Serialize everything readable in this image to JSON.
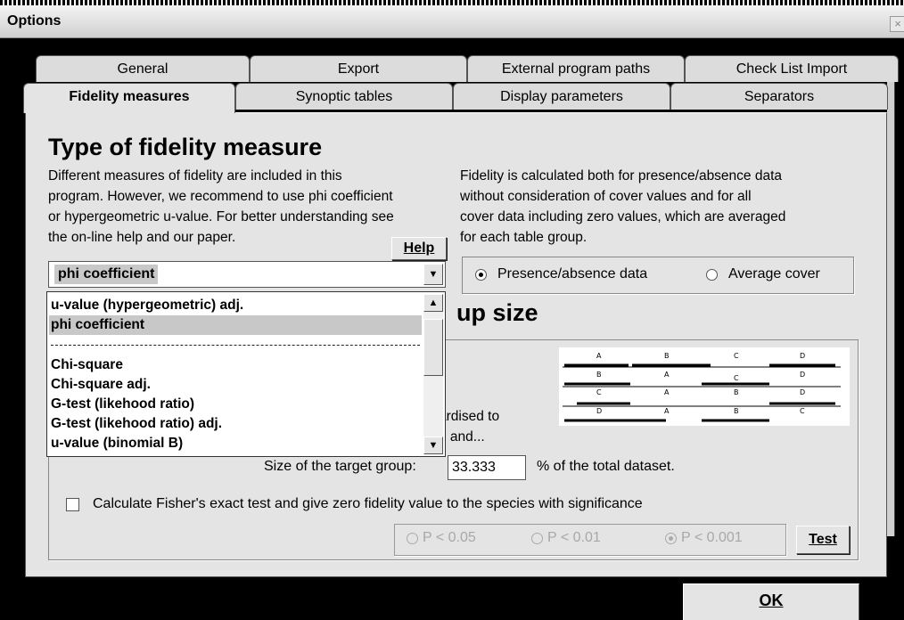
{
  "window": {
    "title": "Options",
    "close_glyph": "×"
  },
  "tabs_row1": [
    "General",
    "Export",
    "External program paths",
    "Check List Import"
  ],
  "tabs_row2": [
    "Fidelity measures",
    "Synoptic tables",
    "Display parameters",
    "Separators"
  ],
  "active_tab": "Fidelity measures",
  "fidelity": {
    "heading": "Type of fidelity measure",
    "left_text": [
      "Different measures of fidelity are included in this",
      "program. However, we recommend to use phi coefficient",
      "or hypergeometric u-value. For better understanding see",
      "the on-line help and our paper."
    ],
    "right_text": [
      "Fidelity is calculated both for presence/absence data",
      "without consideration of cover values and for all",
      "cover data including zero values, which are averaged",
      "for each table group."
    ],
    "help_button": "Help",
    "combo_value": "phi coefficient",
    "dropdown_items": [
      "u-value (hypergeometric) adj.",
      "phi coefficient",
      "Chi-square",
      "Chi-square adj.",
      "G-test (likehood ratio)",
      "G-test (likehood ratio) adj.",
      "u-value (binomial B)"
    ],
    "dropdown_highlighted": "phi coefficient",
    "data_options": [
      {
        "label": "Presence/absence data",
        "checked": true
      },
      {
        "label": "Average cover",
        "checked": false
      }
    ]
  },
  "group_size": {
    "heading_visible": "up size",
    "partial_text": [
      "ardised to",
      "e and..."
    ],
    "target_label": "Size of the target group:",
    "target_value": "33.333",
    "target_suffix": "% of the total dataset.",
    "diagram_letters": [
      [
        "A",
        "B",
        "C",
        "D"
      ],
      [
        "B",
        "A",
        "C",
        "D"
      ],
      [
        "C",
        "A",
        "B",
        "D"
      ],
      [
        "D",
        "A",
        "B",
        "C"
      ]
    ]
  },
  "fisher": {
    "checkbox_label": "Calculate Fisher's exact test and give zero fidelity value to the species with significance",
    "checked": false,
    "p_options": [
      {
        "label": "P < 0.05",
        "checked": false
      },
      {
        "label": "P < 0.01",
        "checked": false
      },
      {
        "label": "P < 0.001",
        "checked": true
      }
    ],
    "test_button": "Test"
  },
  "ok_button": "OK",
  "icons": {
    "combo_arrow": "▼",
    "scroll_up": "▲",
    "scroll_down": "▼"
  }
}
